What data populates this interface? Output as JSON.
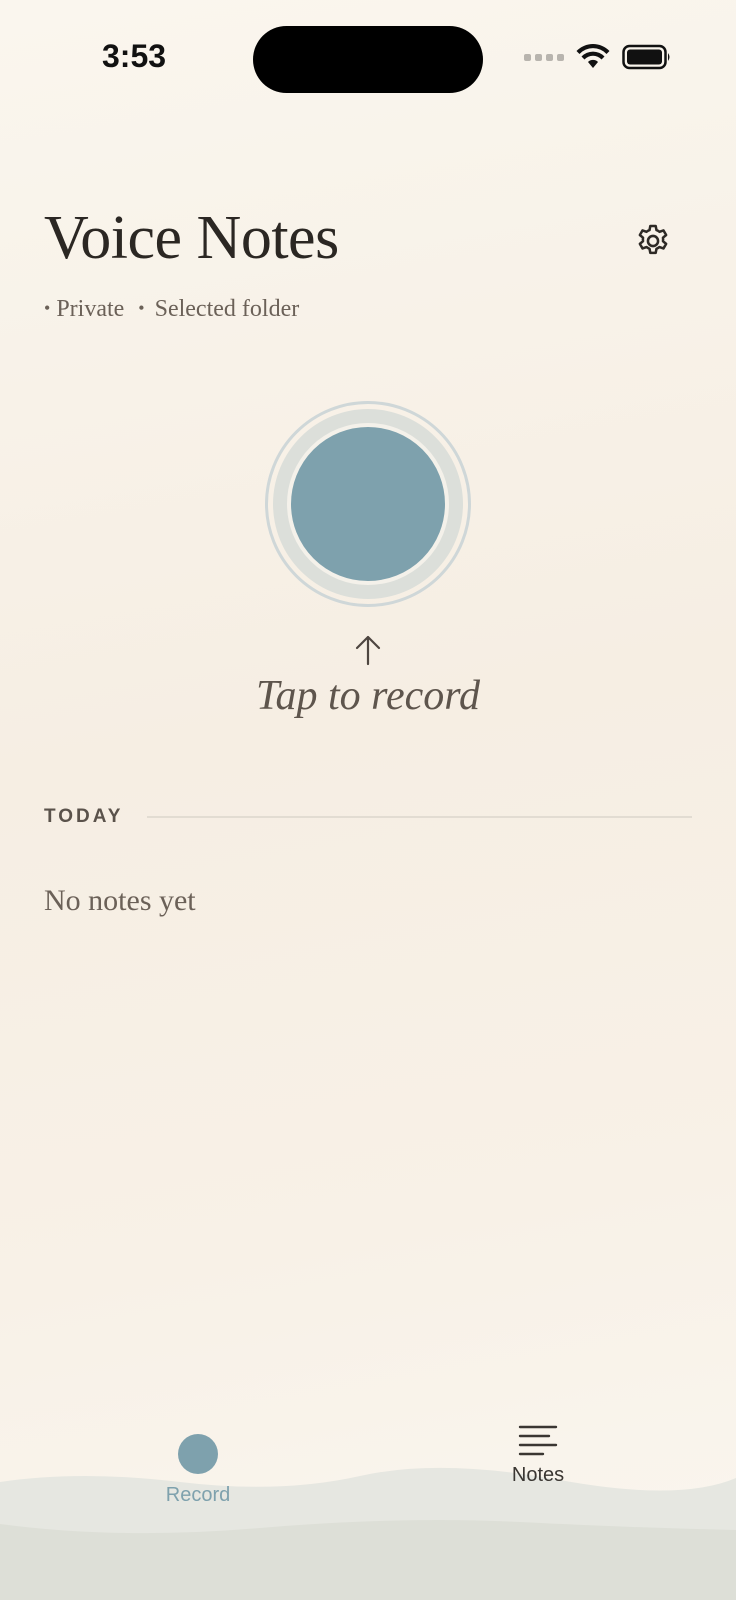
{
  "status_bar": {
    "time": "3:53"
  },
  "header": {
    "title": "Voice Notes",
    "settings_icon": "gear-icon",
    "meta": {
      "privacy": "Private",
      "location": "Selected folder"
    }
  },
  "recorder": {
    "hint": "Tap to record",
    "accent": "#7ea1ad"
  },
  "notes_section": {
    "header": "TODAY",
    "empty_text": "No notes yet"
  },
  "tab_bar": {
    "tabs": [
      {
        "label": "Record",
        "icon": "record-dot-icon",
        "active": true
      },
      {
        "label": "Notes",
        "icon": "list-lines-icon",
        "active": false
      }
    ]
  }
}
